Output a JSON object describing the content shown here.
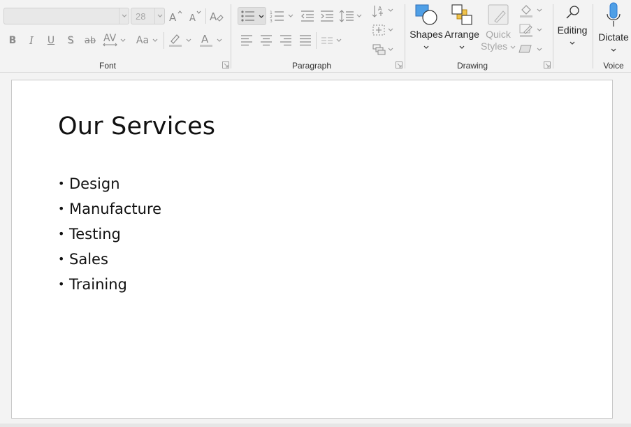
{
  "ribbon": {
    "font": {
      "group_label": "Font",
      "font_name_value": "",
      "font_size_value": "28",
      "bold_label": "B",
      "italic_label": "I",
      "underline_label": "U",
      "shadow_label": "S",
      "strikethrough_label": "ab",
      "spacing_label": "AV",
      "case_label": "Aa"
    },
    "paragraph": {
      "group_label": "Paragraph"
    },
    "drawing": {
      "group_label": "Drawing",
      "shapes_label": "Shapes",
      "arrange_label": "Arrange",
      "quick_styles_line1": "Quick",
      "quick_styles_line2": "Styles"
    },
    "editing": {
      "label": "Editing"
    },
    "voice": {
      "group_label": "Voice",
      "dictate_label": "Dictate"
    },
    "colors": {
      "highlight": "#c8c8c8",
      "font_color": "#c8c8c8",
      "shape_blue": "#4f9fe6",
      "arrange_gold": "#f0c24a",
      "mic_blue": "#2b79d1"
    }
  },
  "slide": {
    "title": "Our Services",
    "bullet_glyph": "•",
    "bullets": [
      "Design",
      "Manufacture",
      "Testing",
      "Sales",
      "Training"
    ]
  }
}
